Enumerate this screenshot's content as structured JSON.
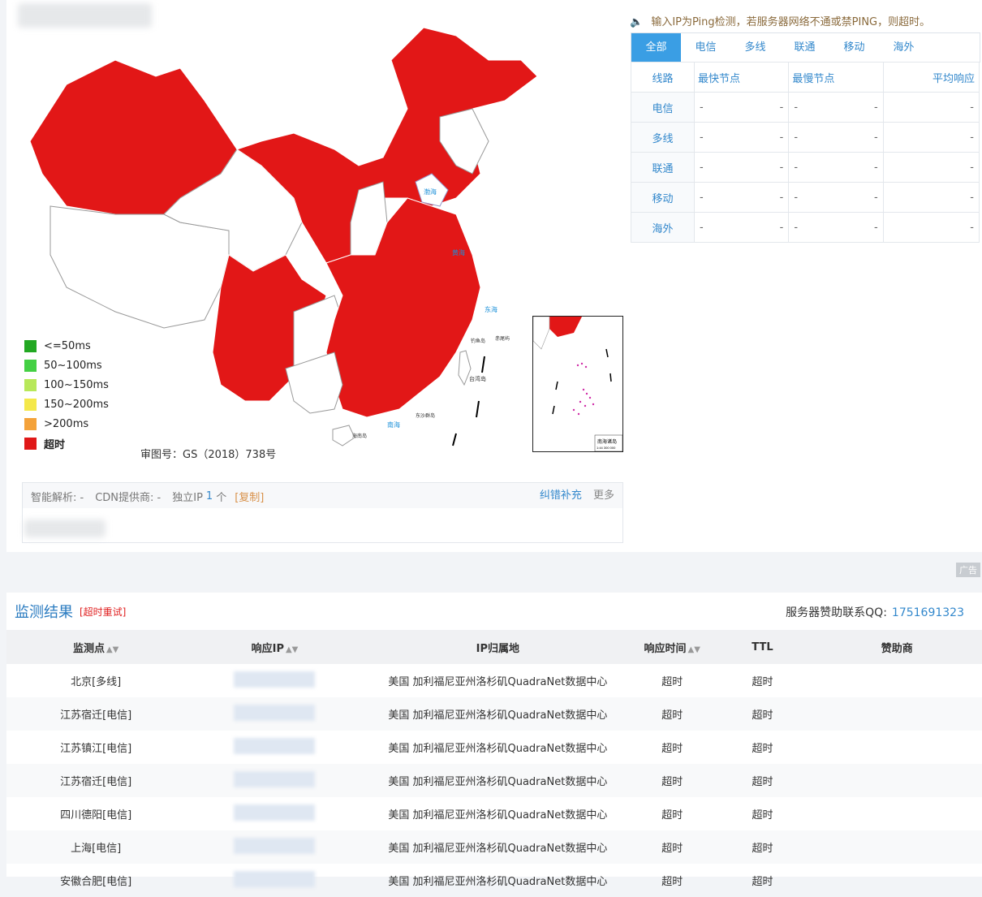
{
  "notice": "输入IP为Ping检测，若服务器网络不通或禁PING，则超时。",
  "tabs": [
    "全部",
    "电信",
    "多线",
    "联通",
    "移动",
    "海外"
  ],
  "stats_headers": [
    "线路",
    "最快节点",
    "最慢节点",
    "平均响应"
  ],
  "stats_rows": [
    {
      "line": "电信",
      "fast": "-",
      "fast2": "-",
      "slow": "-",
      "slow2": "-",
      "avg": "-"
    },
    {
      "line": "多线",
      "fast": "-",
      "fast2": "-",
      "slow": "-",
      "slow2": "-",
      "avg": "-"
    },
    {
      "line": "联通",
      "fast": "-",
      "fast2": "-",
      "slow": "-",
      "slow2": "-",
      "avg": "-"
    },
    {
      "line": "移动",
      "fast": "-",
      "fast2": "-",
      "slow": "-",
      "slow2": "-",
      "avg": "-"
    },
    {
      "line": "海外",
      "fast": "-",
      "fast2": "-",
      "slow": "-",
      "slow2": "-",
      "avg": "-"
    }
  ],
  "legend": [
    {
      "label": "<=50ms",
      "color": "#22a822"
    },
    {
      "label": "50~100ms",
      "color": "#44d044"
    },
    {
      "label": "100~150ms",
      "color": "#b8e85a"
    },
    {
      "label": "150~200ms",
      "color": "#f4e84a"
    },
    {
      "label": ">200ms",
      "color": "#f4a23a"
    },
    {
      "label": "超时",
      "color": "#e01818"
    }
  ],
  "approval": "审图号：GS（2018）738号",
  "map_labels": {
    "bohai": "渤海",
    "yellow": "黄海",
    "east": "东海",
    "south": "南海",
    "taiwan": "台湾岛",
    "hainan": "海南岛",
    "dongsha": "东沙群岛",
    "diaoyu": "钓鱼岛",
    "chiwei": "赤尾屿",
    "inset_title": "南海诸岛",
    "inset_scale": "1:44 300 000"
  },
  "dns": {
    "smart": "智能解析: -",
    "cdn": "CDN提供商: -",
    "ip_label": "独立IP",
    "ip_count": "1",
    "ip_unit": "个",
    "copy": "[复制]",
    "fix": "纠错补充",
    "more": "更多"
  },
  "ad": "广告",
  "result": {
    "title": "监测结果",
    "retry": "[超时重试]",
    "sponsor_label": "服务器赞助联系QQ:",
    "sponsor_qq": "1751691323",
    "headers": [
      "监测点",
      "响应IP",
      "IP归属地",
      "响应时间",
      "TTL",
      "赞助商"
    ],
    "rows": [
      {
        "point": "北京[多线]",
        "loc": "美国 加利福尼亚州洛杉矶QuadraNet数据中心",
        "time": "超时",
        "ttl": "超时"
      },
      {
        "point": "江苏宿迁[电信]",
        "loc": "美国 加利福尼亚州洛杉矶QuadraNet数据中心",
        "time": "超时",
        "ttl": "超时"
      },
      {
        "point": "江苏镇江[电信]",
        "loc": "美国 加利福尼亚州洛杉矶QuadraNet数据中心",
        "time": "超时",
        "ttl": "超时"
      },
      {
        "point": "江苏宿迁[电信]",
        "loc": "美国 加利福尼亚州洛杉矶QuadraNet数据中心",
        "time": "超时",
        "ttl": "超时"
      },
      {
        "point": "四川德阳[电信]",
        "loc": "美国 加利福尼亚州洛杉矶QuadraNet数据中心",
        "time": "超时",
        "ttl": "超时"
      },
      {
        "point": "上海[电信]",
        "loc": "美国 加利福尼亚州洛杉矶QuadraNet数据中心",
        "time": "超时",
        "ttl": "超时"
      },
      {
        "point": "安徽合肥[电信]",
        "loc": "美国 加利福尼亚州洛杉矶QuadraNet数据中心",
        "time": "超时",
        "ttl": "超时"
      }
    ]
  }
}
